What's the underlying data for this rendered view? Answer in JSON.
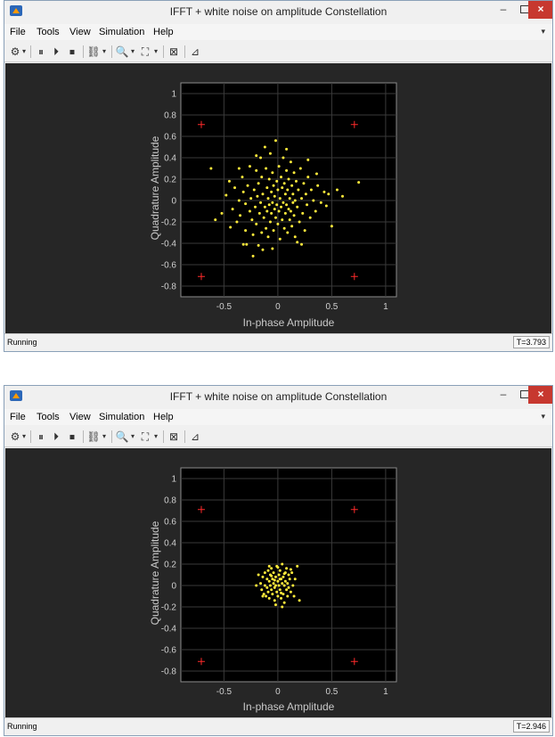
{
  "windows": [
    {
      "title": "IFFT + white noise on amplitude Constellation",
      "menu": [
        "File",
        "Tools",
        "View",
        "Simulation",
        "Help"
      ],
      "status": "Running",
      "time": "T=3.793",
      "xlabel": "In-phase Amplitude",
      "ylabel": "Quadrature Amplitude",
      "chart_data": {
        "type": "scatter",
        "xlim": [
          -0.9,
          1.1
        ],
        "ylim": [
          -0.9,
          1.1
        ],
        "xticks": [
          -0.5,
          0,
          0.5,
          1
        ],
        "yticks": [
          1,
          0.8,
          0.6,
          0.4,
          0.2,
          0,
          -0.2,
          -0.4,
          -0.6,
          -0.8
        ],
        "grid": true,
        "reference": [
          [
            -0.71,
            0.71
          ],
          [
            0.71,
            0.71
          ],
          [
            -0.71,
            -0.71
          ],
          [
            0.71,
            -0.71
          ]
        ],
        "points": [
          [
            -0.62,
            0.3
          ],
          [
            -0.58,
            -0.18
          ],
          [
            -0.52,
            -0.12
          ],
          [
            -0.48,
            0.05
          ],
          [
            -0.45,
            0.18
          ],
          [
            -0.42,
            -0.08
          ],
          [
            -0.4,
            0.12
          ],
          [
            -0.38,
            -0.2
          ],
          [
            -0.36,
            0.0
          ],
          [
            -0.35,
            -0.14
          ],
          [
            -0.33,
            0.22
          ],
          [
            -0.32,
            0.08
          ],
          [
            -0.3,
            -0.03
          ],
          [
            -0.3,
            -0.28
          ],
          [
            -0.28,
            0.14
          ],
          [
            -0.26,
            -0.1
          ],
          [
            -0.26,
            0.32
          ],
          [
            -0.25,
            0.02
          ],
          [
            -0.24,
            -0.18
          ],
          [
            -0.23,
            -0.32
          ],
          [
            -0.22,
            0.1
          ],
          [
            -0.21,
            -0.06
          ],
          [
            -0.2,
            0.28
          ],
          [
            -0.2,
            -0.22
          ],
          [
            -0.19,
            0.04
          ],
          [
            -0.18,
            -0.42
          ],
          [
            -0.18,
            0.16
          ],
          [
            -0.17,
            -0.12
          ],
          [
            -0.16,
            0.4
          ],
          [
            -0.16,
            -0.02
          ],
          [
            -0.15,
            -0.3
          ],
          [
            -0.15,
            0.22
          ],
          [
            -0.14,
            0.06
          ],
          [
            -0.13,
            -0.16
          ],
          [
            -0.12,
            0.5
          ],
          [
            -0.12,
            -0.06
          ],
          [
            -0.11,
            0.3
          ],
          [
            -0.11,
            -0.26
          ],
          [
            -0.1,
            0.12
          ],
          [
            -0.1,
            -0.1
          ],
          [
            -0.09,
            0.02
          ],
          [
            -0.09,
            -0.34
          ],
          [
            -0.08,
            0.2
          ],
          [
            -0.08,
            -0.04
          ],
          [
            -0.07,
            0.44
          ],
          [
            -0.07,
            -0.2
          ],
          [
            -0.06,
            0.08
          ],
          [
            -0.06,
            -0.12
          ],
          [
            -0.05,
            0.26
          ],
          [
            -0.05,
            -0.02
          ],
          [
            -0.04,
            -0.28
          ],
          [
            -0.04,
            0.14
          ],
          [
            -0.03,
            0.04
          ],
          [
            -0.03,
            -0.08
          ],
          [
            -0.02,
            0.56
          ],
          [
            -0.02,
            -0.16
          ],
          [
            -0.01,
            0.18
          ],
          [
            -0.01,
            -0.04
          ],
          [
            0.0,
            0.1
          ],
          [
            0.0,
            -0.22
          ],
          [
            0.01,
            0.32
          ],
          [
            0.01,
            -0.1
          ],
          [
            0.02,
            0.02
          ],
          [
            0.02,
            -0.36
          ],
          [
            0.03,
            0.22
          ],
          [
            0.03,
            -0.06
          ],
          [
            0.04,
            0.12
          ],
          [
            0.04,
            -0.18
          ],
          [
            0.05,
            0.4
          ],
          [
            0.05,
            -0.02
          ],
          [
            0.06,
            -0.26
          ],
          [
            0.06,
            0.16
          ],
          [
            0.07,
            0.06
          ],
          [
            0.07,
            -0.12
          ],
          [
            0.08,
            0.28
          ],
          [
            0.08,
            -0.04
          ],
          [
            0.09,
            0.1
          ],
          [
            0.09,
            -0.3
          ],
          [
            0.1,
            0.2
          ],
          [
            0.1,
            -0.08
          ],
          [
            0.11,
            0.02
          ],
          [
            0.11,
            -0.18
          ],
          [
            0.12,
            0.36
          ],
          [
            0.12,
            -0.1
          ],
          [
            0.13,
            0.14
          ],
          [
            0.13,
            -0.24
          ],
          [
            0.14,
            0.06
          ],
          [
            0.14,
            -0.02
          ],
          [
            0.15,
            0.26
          ],
          [
            0.15,
            -0.14
          ],
          [
            0.16,
            0.0
          ],
          [
            0.16,
            -0.34
          ],
          [
            0.17,
            0.18
          ],
          [
            0.18,
            -0.06
          ],
          [
            0.19,
            0.1
          ],
          [
            0.2,
            -0.2
          ],
          [
            0.21,
            0.3
          ],
          [
            0.22,
            0.02
          ],
          [
            0.23,
            -0.12
          ],
          [
            0.24,
            0.16
          ],
          [
            0.25,
            -0.28
          ],
          [
            0.26,
            0.06
          ],
          [
            0.27,
            -0.04
          ],
          [
            0.28,
            0.22
          ],
          [
            0.3,
            -0.16
          ],
          [
            0.31,
            0.1
          ],
          [
            0.33,
            0.0
          ],
          [
            0.35,
            -0.1
          ],
          [
            0.37,
            0.14
          ],
          [
            0.4,
            -0.02
          ],
          [
            0.43,
            0.08
          ],
          [
            0.47,
            0.06
          ],
          [
            0.5,
            -0.24
          ],
          [
            0.55,
            0.1
          ],
          [
            0.6,
            0.04
          ],
          [
            0.75,
            0.17
          ],
          [
            -0.32,
            -0.41
          ],
          [
            -0.29,
            -0.41
          ],
          [
            -0.23,
            -0.52
          ],
          [
            0.18,
            -0.39
          ],
          [
            -0.44,
            -0.25
          ],
          [
            0.45,
            -0.05
          ],
          [
            -0.05,
            -0.45
          ],
          [
            0.28,
            0.38
          ],
          [
            -0.2,
            0.42
          ],
          [
            0.36,
            0.25
          ],
          [
            0.08,
            0.48
          ],
          [
            -0.36,
            0.3
          ],
          [
            0.22,
            -0.41
          ],
          [
            -0.14,
            -0.46
          ]
        ]
      }
    },
    {
      "title": "IFFT + white noise on amplitude Constellation",
      "menu": [
        "File",
        "Tools",
        "View",
        "Simulation",
        "Help"
      ],
      "status": "Running",
      "time": "T=2.946",
      "xlabel": "In-phase Amplitude",
      "ylabel": "Quadrature Amplitude",
      "chart_data": {
        "type": "scatter",
        "xlim": [
          -0.9,
          1.1
        ],
        "ylim": [
          -0.9,
          1.1
        ],
        "xticks": [
          -0.5,
          0,
          0.5,
          1
        ],
        "yticks": [
          1,
          0.8,
          0.6,
          0.4,
          0.2,
          0,
          -0.2,
          -0.4,
          -0.6,
          -0.8
        ],
        "grid": true,
        "reference": [
          [
            -0.71,
            0.71
          ],
          [
            0.71,
            0.71
          ],
          [
            -0.71,
            -0.71
          ],
          [
            0.71,
            -0.71
          ]
        ],
        "points": [
          [
            -0.18,
            0.1
          ],
          [
            -0.16,
            0.02
          ],
          [
            -0.15,
            -0.04
          ],
          [
            -0.14,
            0.08
          ],
          [
            -0.13,
            -0.08
          ],
          [
            -0.12,
            0.12
          ],
          [
            -0.12,
            0.0
          ],
          [
            -0.11,
            -0.1
          ],
          [
            -0.1,
            0.06
          ],
          [
            -0.1,
            -0.02
          ],
          [
            -0.09,
            0.14
          ],
          [
            -0.09,
            -0.06
          ],
          [
            -0.08,
            0.04
          ],
          [
            -0.08,
            -0.12
          ],
          [
            -0.07,
            0.1
          ],
          [
            -0.07,
            0.0
          ],
          [
            -0.06,
            -0.04
          ],
          [
            -0.06,
            0.16
          ],
          [
            -0.05,
            0.06
          ],
          [
            -0.05,
            -0.08
          ],
          [
            -0.04,
            0.02
          ],
          [
            -0.04,
            0.12
          ],
          [
            -0.03,
            -0.02
          ],
          [
            -0.03,
            -0.14
          ],
          [
            -0.02,
            0.08
          ],
          [
            -0.02,
            0.0
          ],
          [
            -0.01,
            0.18
          ],
          [
            -0.01,
            -0.06
          ],
          [
            0.0,
            0.04
          ],
          [
            0.0,
            -0.1
          ],
          [
            0.01,
            0.1
          ],
          [
            0.01,
            0.0
          ],
          [
            0.02,
            -0.04
          ],
          [
            0.02,
            0.14
          ],
          [
            0.03,
            0.06
          ],
          [
            0.03,
            -0.12
          ],
          [
            0.04,
            0.02
          ],
          [
            0.04,
            0.2
          ],
          [
            0.05,
            -0.08
          ],
          [
            0.05,
            0.08
          ],
          [
            0.06,
            0.0
          ],
          [
            0.06,
            -0.16
          ],
          [
            0.07,
            0.12
          ],
          [
            0.07,
            0.04
          ],
          [
            0.08,
            -0.04
          ],
          [
            0.08,
            0.16
          ],
          [
            0.09,
            0.02
          ],
          [
            0.09,
            -0.1
          ],
          [
            0.1,
            0.1
          ],
          [
            0.1,
            -0.02
          ],
          [
            0.11,
            0.06
          ],
          [
            0.12,
            -0.06
          ],
          [
            0.13,
            0.12
          ],
          [
            0.14,
            0.0
          ],
          [
            0.15,
            -0.1
          ],
          [
            0.16,
            0.06
          ],
          [
            0.18,
            0.18
          ],
          [
            0.2,
            -0.14
          ],
          [
            -0.2,
            0.0
          ],
          [
            -0.02,
            -0.18
          ],
          [
            0.0,
            0.17
          ],
          [
            0.04,
            -0.2
          ],
          [
            -0.08,
            0.18
          ],
          [
            0.12,
            0.15
          ],
          [
            -0.14,
            -0.1
          ],
          [
            0.06,
            0.11
          ],
          [
            -0.06,
            0.09
          ],
          [
            0.03,
            -0.07
          ],
          [
            -0.03,
            0.05
          ],
          [
            0.02,
            0.06
          ]
        ]
      }
    }
  ]
}
